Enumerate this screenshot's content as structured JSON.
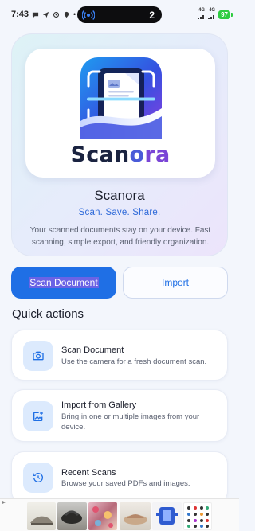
{
  "status_bar": {
    "time": "7:43",
    "live_activity_count": "2",
    "network_1": "4G",
    "network_2": "4G",
    "battery": "97"
  },
  "hero": {
    "logo_word_part1": "Scan",
    "logo_word_part2": "o",
    "logo_word_part3": "ra",
    "app_name": "Scanora",
    "tagline": "Scan. Save. Share.",
    "description": "Your scanned documents stay on your device. Fast scanning, simple export, and friendly organization."
  },
  "buttons": {
    "scan_label": "Scan Document",
    "import_label": "Import"
  },
  "quick_actions": {
    "title": "Quick actions",
    "items": [
      {
        "title": "Scan Document",
        "desc": "Use the camera for a fresh document scan.",
        "icon": "camera-icon"
      },
      {
        "title": "Import from Gallery",
        "desc": "Bring in one or multiple images from your device.",
        "icon": "add-photo-icon"
      },
      {
        "title": "Recent Scans",
        "desc": "Browse your saved PDFs and images.",
        "icon": "history-icon"
      }
    ]
  },
  "ad": {
    "thumbnails": [
      "shoe-thumbnail",
      "sandal-thumbnail",
      "fabric-thumbnail",
      "slipper-thumbnail",
      "harness-thumbnail",
      "stickers-thumbnail"
    ]
  },
  "colors": {
    "primary": "#1f6fe5",
    "background": "#f3f6fc",
    "icon_tile": "#dceafd",
    "battery": "#2ecc40"
  }
}
